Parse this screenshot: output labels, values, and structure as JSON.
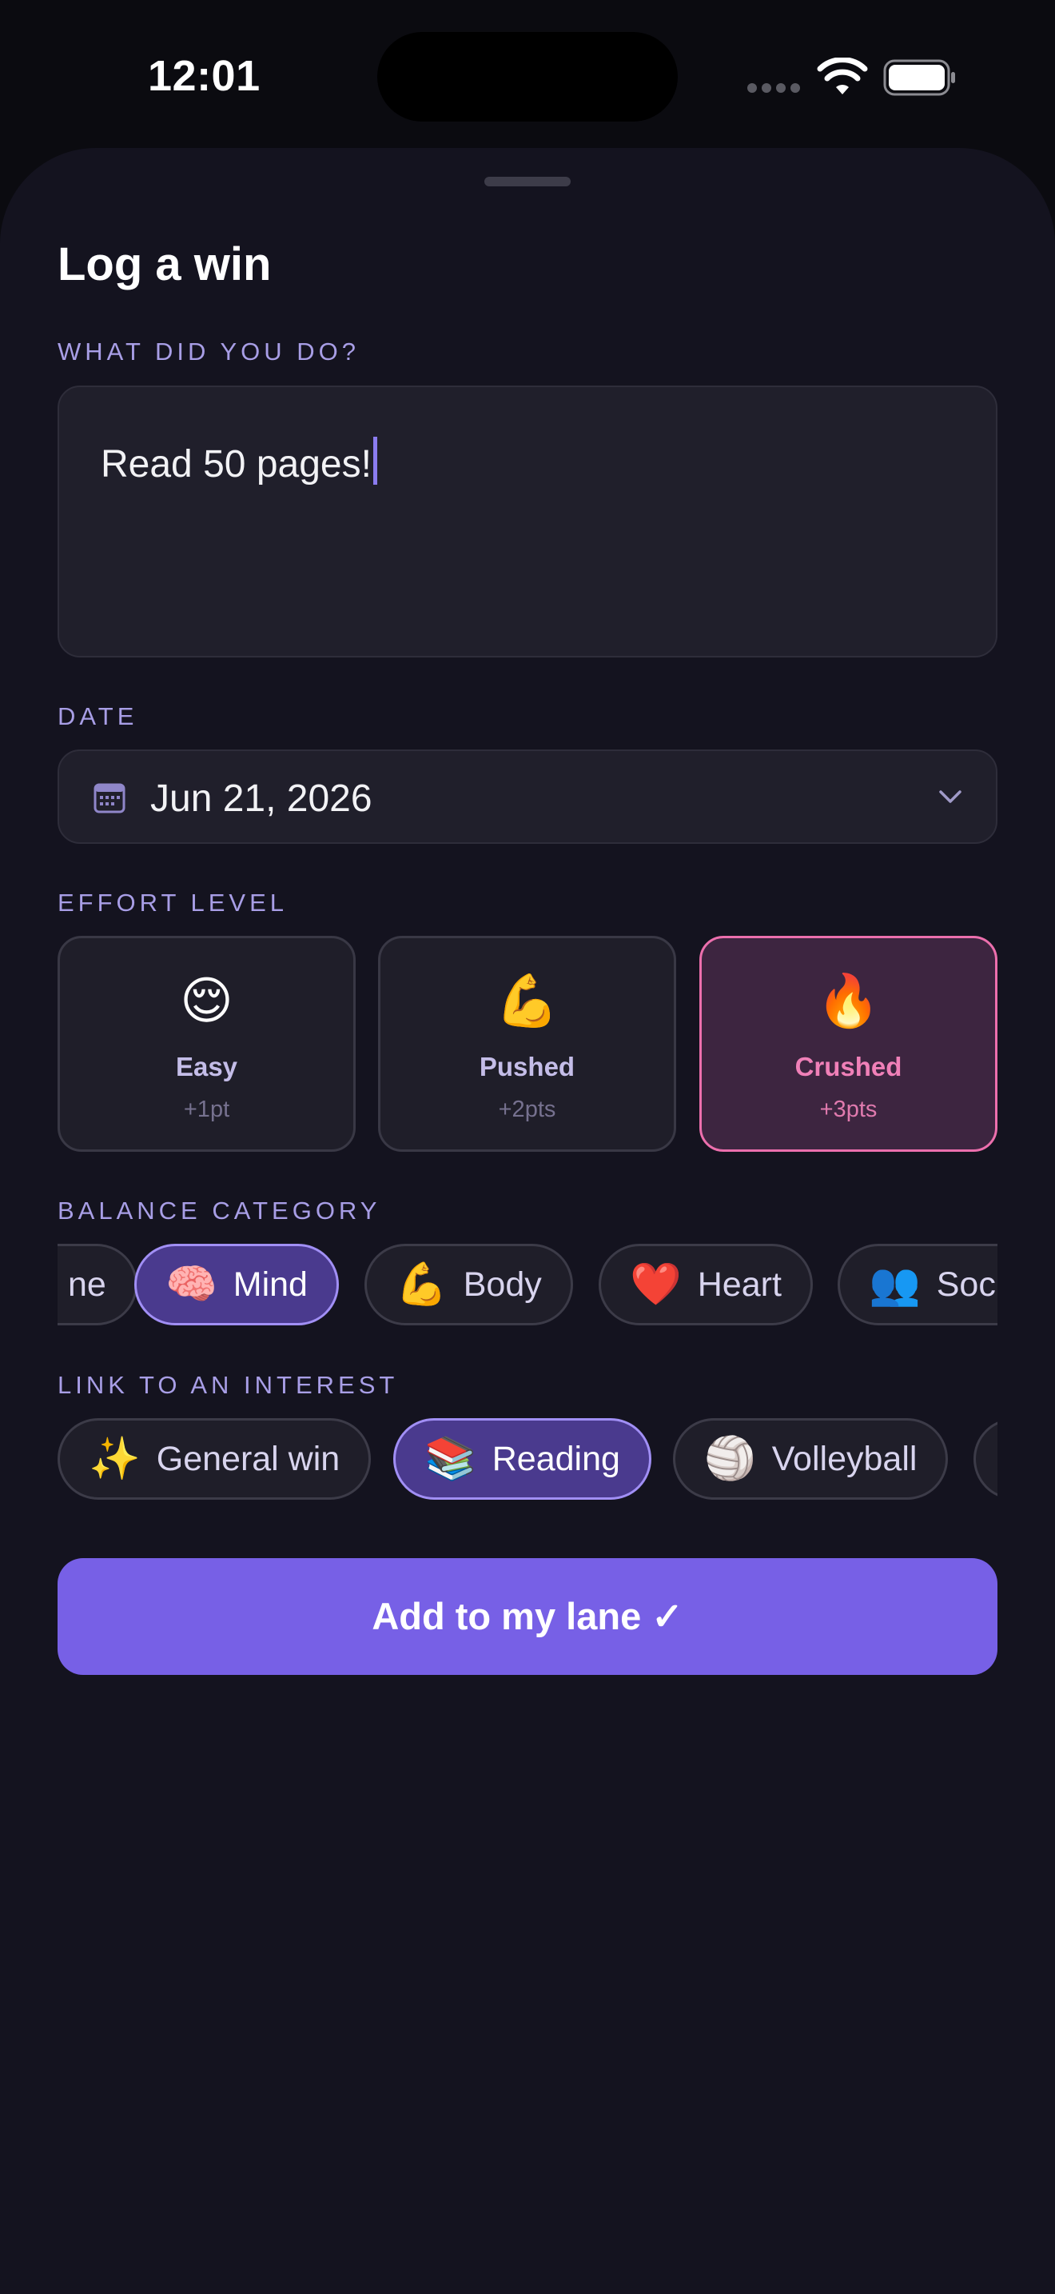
{
  "status_bar": {
    "time": "12:01",
    "wifi_icon": "wifi-icon",
    "battery_icon": "battery-full-icon"
  },
  "sheet": {
    "title": "Log a win",
    "what": {
      "label": "WHAT DID YOU DO?",
      "value": "Read 50 pages!"
    },
    "date": {
      "label": "DATE",
      "value": "Jun 21, 2026",
      "icon": "calendar-icon"
    },
    "effort": {
      "label": "EFFORT LEVEL",
      "options": [
        {
          "emoji": "😌",
          "name": "Easy",
          "points": "+1pt",
          "selected": false
        },
        {
          "emoji": "💪",
          "name": "Pushed",
          "points": "+2pts",
          "selected": false
        },
        {
          "emoji": "🔥",
          "name": "Crushed",
          "points": "+3pts",
          "selected": true
        }
      ]
    },
    "balance": {
      "label": "BALANCE CATEGORY",
      "chips": [
        {
          "emoji": "",
          "label": "ne",
          "selected": false
        },
        {
          "emoji": "🧠",
          "label": "Mind",
          "selected": true
        },
        {
          "emoji": "💪",
          "label": "Body",
          "selected": false
        },
        {
          "emoji": "❤️",
          "label": "Heart",
          "selected": false
        },
        {
          "emoji": "👥",
          "label": "Soc",
          "selected": false
        }
      ]
    },
    "interest": {
      "label": "LINK TO AN INTEREST",
      "chips": [
        {
          "emoji": "✨",
          "label": "General win",
          "selected": false
        },
        {
          "emoji": "📚",
          "label": "Reading",
          "selected": true
        },
        {
          "emoji": "🏐",
          "label": "Volleyball",
          "selected": false
        },
        {
          "emoji": "",
          "label": "",
          "selected": false
        }
      ]
    },
    "submit_label": "Add to my lane ✓"
  },
  "colors": {
    "background": "#14131f",
    "accent": "#7760e6",
    "selected_effort": "#ec6fad",
    "label": "#a89ee6"
  }
}
